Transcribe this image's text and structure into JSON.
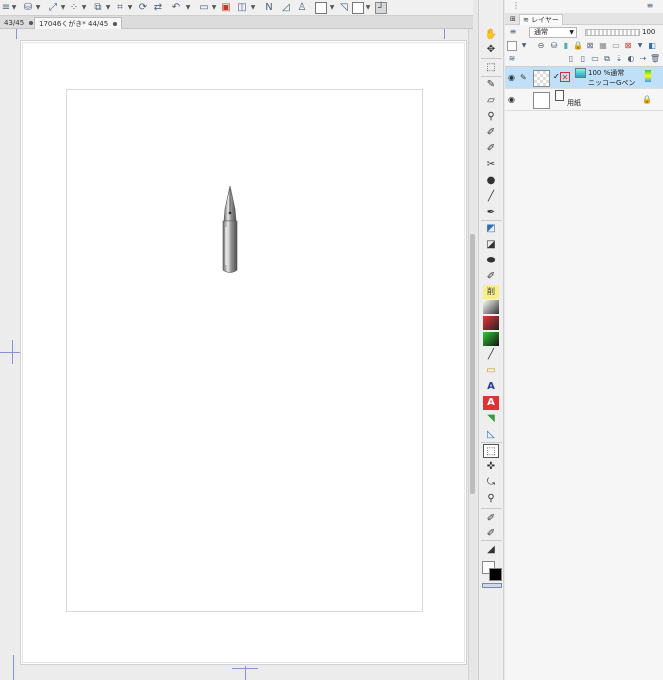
{
  "tabs": [
    {
      "label": "43/45"
    },
    {
      "label": "17046くがき* 44/45"
    }
  ],
  "layer_panel": {
    "tab_label": "レイヤー",
    "blend_mode": "通常",
    "opacity": "100",
    "layers": [
      {
        "name_line1": "100 %通常",
        "name_line2": "ニッコーGペン",
        "selected": true
      },
      {
        "name_line1": "用紙",
        "selected": false
      }
    ]
  },
  "colors": {
    "guide": "#8b8fd6",
    "selection": "#bfe0f7",
    "canvas_bg": "#ececec",
    "paper": "#ffffff"
  }
}
